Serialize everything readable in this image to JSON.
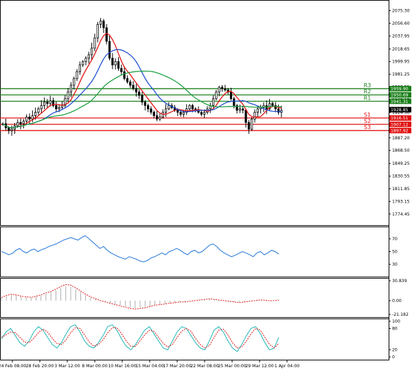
{
  "chart_data": [
    {
      "type": "candlestick",
      "title": "",
      "ylim": [
        1760,
        2085
      ],
      "y_ticks": [
        "2075.30",
        "2056.60",
        "2037.95",
        "2018.65",
        "1999.95",
        "1981.25",
        "1962.55",
        "1943.15",
        "1924.50",
        "1905.80",
        "1887.20",
        "1868.50",
        "1849.25",
        "1830.55",
        "1811.85",
        "1793.15",
        "1774.45"
      ],
      "x_ticks": [
        "24 Feb 08:00",
        "28 Feb 20:00",
        "3 Mar 12:00",
        "8 Mar 00:00",
        "10 Mar 16:00",
        "15 Mar 04:00",
        "17 Mar 20:00",
        "22 Mar 08:00",
        "25 Mar 00:00",
        "29 Mar 12:00",
        "1 Apr 04:00"
      ],
      "current_price": "1928.85",
      "levels": [
        {
          "name": "R3",
          "value": 1959.9,
          "label": "1959.90",
          "color": "#1a7f1a"
        },
        {
          "name": "R2",
          "value": 1950.69,
          "label": "1950.69",
          "color": "#1a7f1a"
        },
        {
          "name": "R1",
          "value": 1941.31,
          "label": "1941.31",
          "color": "#1a7f1a"
        },
        {
          "name": "S1",
          "value": 1916.51,
          "label": "1916.51",
          "color": "#e01010"
        },
        {
          "name": "S2",
          "value": 1907.12,
          "label": "1907.12",
          "color": "#e01010"
        },
        {
          "name": "S3",
          "value": 1897.92,
          "label": "1897.92",
          "color": "#e01010"
        }
      ],
      "close_series": [
        1908,
        1902,
        1898,
        1900,
        1905,
        1910,
        1908,
        1912,
        1918,
        1915,
        1920,
        1925,
        1930,
        1935,
        1940,
        1938,
        1942,
        1935,
        1930,
        1932,
        1935,
        1945,
        1955,
        1965,
        1975,
        1985,
        1995,
        2000,
        2005,
        2010,
        2020,
        2035,
        2055,
        2060,
        2050,
        2030,
        2005,
        1995,
        2000,
        1990,
        1985,
        1975,
        1970,
        1965,
        1960,
        1955,
        1950,
        1940,
        1935,
        1930,
        1925,
        1920,
        1915,
        1918,
        1925,
        1930,
        1935,
        1932,
        1928,
        1925,
        1922,
        1925,
        1930,
        1935,
        1930,
        1928,
        1925,
        1922,
        1925,
        1930,
        1935,
        1945,
        1955,
        1962,
        1960,
        1958,
        1955,
        1945,
        1935,
        1928,
        1930,
        1928,
        1910,
        1900,
        1915,
        1925,
        1930,
        1932,
        1935,
        1930,
        1938,
        1935,
        1930,
        1925,
        1928
      ],
      "moving_averages": [
        {
          "color": "#e01010",
          "period_hint": "fast"
        },
        {
          "color": "#2050d0",
          "period_hint": "medium"
        },
        {
          "color": "#20a040",
          "period_hint": "slow"
        }
      ]
    },
    {
      "type": "line",
      "ylim": [
        15,
        85
      ],
      "y_ticks": [
        "70",
        "50",
        "30"
      ],
      "series": [
        {
          "color": "#1e74d8",
          "values": [
            50,
            48,
            45,
            47,
            52,
            55,
            50,
            48,
            52,
            54,
            50,
            53,
            55,
            58,
            60,
            62,
            65,
            68,
            70,
            72,
            70,
            68,
            72,
            75,
            70,
            65,
            60,
            55,
            58,
            52,
            48,
            45,
            42,
            40,
            38,
            42,
            40,
            38,
            35,
            34,
            36,
            40,
            42,
            45,
            48,
            45,
            50,
            52,
            55,
            52,
            48,
            45,
            50,
            52,
            48,
            50,
            55,
            60,
            62,
            58,
            52,
            48,
            45,
            42,
            44,
            47,
            50,
            48,
            45,
            42,
            48,
            50,
            45,
            48,
            52,
            50,
            46
          ]
        }
      ]
    },
    {
      "type": "line",
      "ylim": [
        -21.182,
        30.839
      ],
      "y_ticks": [
        "30.839",
        "0.00",
        "-21.182"
      ],
      "series": [
        {
          "color": "#e01010",
          "values": [
            5,
            8,
            10,
            9,
            7,
            6,
            5,
            7,
            9,
            12,
            14,
            18,
            22,
            25,
            24,
            20,
            15,
            10,
            6,
            3,
            0,
            -2,
            -4,
            -6,
            -8,
            -10,
            -12,
            -13,
            -12,
            -11,
            -9,
            -7,
            -6,
            -5,
            -4,
            -3,
            -2,
            -2,
            -1,
            0,
            1,
            2,
            3,
            2,
            1,
            0,
            -1,
            -2,
            -3,
            -2,
            -1,
            0,
            1,
            1,
            0,
            0,
            1
          ]
        }
      ]
    },
    {
      "type": "line",
      "ylim": [
        0,
        100
      ],
      "y_ticks": [
        "100",
        "80",
        "20",
        "0"
      ],
      "series": [
        {
          "color": "#1fb5b5",
          "values": [
            50,
            70,
            80,
            60,
            40,
            30,
            45,
            70,
            85,
            75,
            55,
            35,
            25,
            40,
            65,
            85,
            90,
            70,
            45,
            30,
            25,
            40,
            60,
            85,
            90,
            75,
            50,
            30,
            20,
            35,
            55,
            75,
            85,
            65,
            45,
            25,
            20,
            45,
            70,
            85,
            80,
            60,
            40,
            25,
            20,
            45,
            75,
            85,
            70,
            45,
            25,
            15,
            35,
            60,
            80,
            85,
            65,
            40,
            20,
            25,
            55
          ]
        },
        {
          "color": "#e01010",
          "values": [
            55,
            62,
            70,
            68,
            55,
            42,
            40,
            52,
            68,
            78,
            70,
            52,
            38,
            35,
            48,
            68,
            82,
            80,
            62,
            42,
            30,
            35,
            48,
            68,
            82,
            82,
            65,
            45,
            30,
            30,
            45,
            62,
            75,
            72,
            55,
            38,
            28,
            35,
            55,
            72,
            80,
            72,
            52,
            35,
            25,
            32,
            55,
            75,
            78,
            62,
            40,
            25,
            28,
            45,
            65,
            80,
            75,
            55,
            35,
            25,
            38
          ]
        }
      ]
    }
  ]
}
